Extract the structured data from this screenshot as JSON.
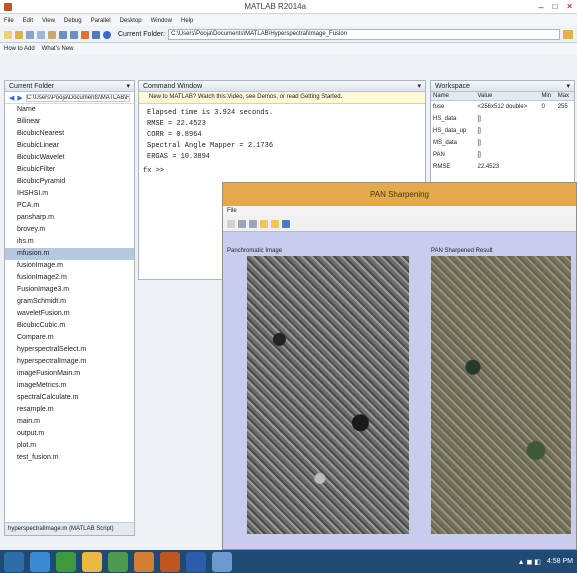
{
  "window": {
    "title": "MATLAB R2014a"
  },
  "menu": [
    "File",
    "Edit",
    "View",
    "Debug",
    "Parallel",
    "Desktop",
    "Window",
    "Help"
  ],
  "toolbar": {
    "current_folder_label": "Current Folder:",
    "path": "C:\\Users\\Pooja\\Documents\\MATLAB\\Hyperspectral\\Image_Fusion"
  },
  "shortcuts": [
    "How to Add",
    "What's New"
  ],
  "colors": {
    "accent": "#e3a94a",
    "selection": "#b7c9e2",
    "figure_bg": "#c8cdee",
    "taskbar": "#1f4a73"
  },
  "current_folder": {
    "title": "Current Folder",
    "files": [
      "Name",
      "Bilinear",
      "BicubicNearest",
      "BicubicLinear",
      "BicubicWavelet",
      "BicubicFilter",
      "BicubicPyramid",
      "IHSHSI.m",
      "PCA.m",
      "pansharp.m",
      "brovey.m",
      "ihs.m",
      "mfusion.m",
      "fusionImage.m",
      "fusionImage2.m",
      "FusionImage3.m",
      "gramSchmidt.m",
      "waveletFusion.m",
      "BicubicCubic.m",
      "Compare.m",
      "hyperspectralSelect.m",
      "hyperspectralImage.m",
      "imageFusionMain.m",
      "imageMetrics.m",
      "spectralCalculate.m",
      "resample.m",
      "main.m",
      "output.m",
      "plot.m",
      "test_fusion.m"
    ],
    "selected_index": 12,
    "status_text": "hyperspectralImage.m (MATLAB Script)"
  },
  "command_window": {
    "title": "Command Window",
    "info": "New to MATLAB? Watch this Video, see Demos, or read Getting Started.",
    "lines": [
      "Elapsed time is 3.924 seconds.",
      "RMSE = 22.4523",
      "CORR = 0.8964",
      "Spectral Angle Mapper = 2.1736",
      "ERGAS = 10.3894"
    ],
    "prompt": "fx >>"
  },
  "workspace": {
    "title": "Workspace",
    "columns": [
      "Name",
      "Value",
      "Min",
      "Max"
    ],
    "rows": [
      [
        "fuse",
        "<256x512 double>",
        "0",
        "255"
      ],
      [
        "HS_data",
        "[]",
        "",
        ""
      ],
      [
        "HS_data_up",
        "[]",
        "",
        ""
      ],
      [
        "MS_data",
        "[]",
        "",
        ""
      ],
      [
        "PAN",
        "[]",
        "",
        ""
      ],
      [
        "RMSE",
        "22.4523",
        "",
        ""
      ]
    ]
  },
  "figure": {
    "title": "PAN Sharpening",
    "menu": "File",
    "left_label": "Panchromatic Image",
    "right_label": "PAN Sharpened Result"
  },
  "taskbar": {
    "clock": "4:58 PM"
  }
}
